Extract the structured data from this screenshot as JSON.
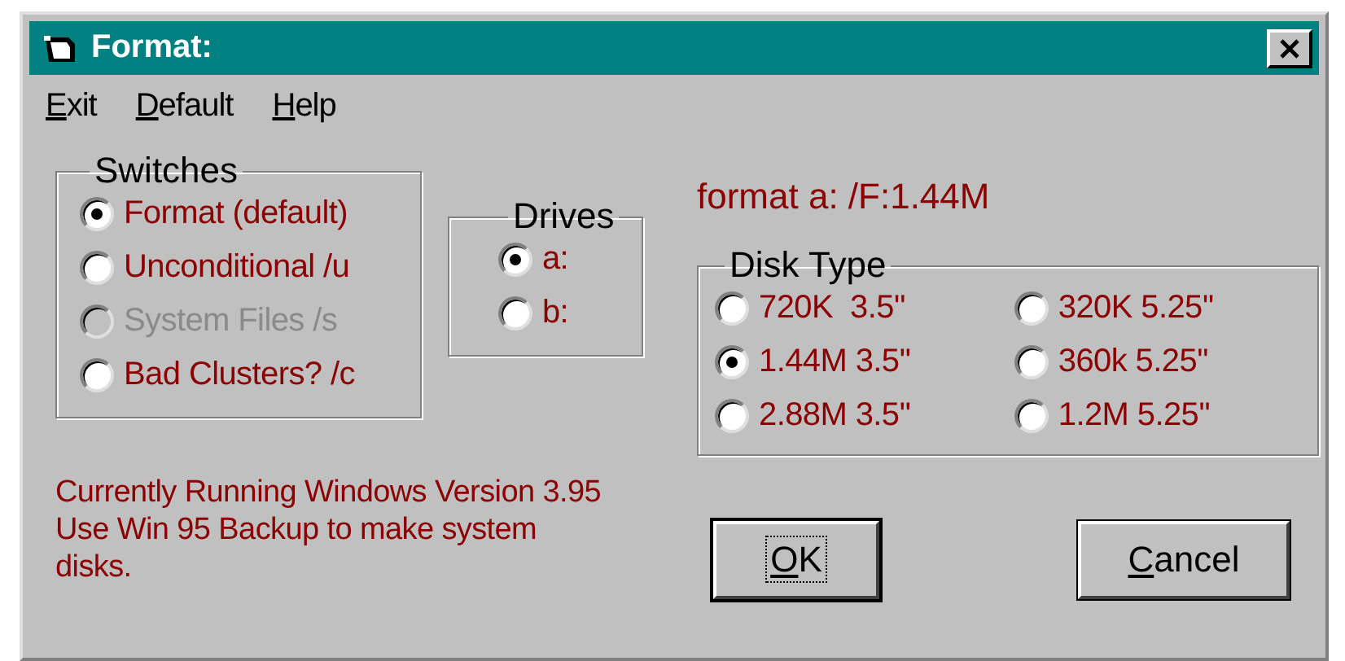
{
  "window": {
    "title": "Format:"
  },
  "menu": [
    {
      "mnemonic": "E",
      "rest": "xit"
    },
    {
      "mnemonic": "D",
      "rest": "efault"
    },
    {
      "mnemonic": "H",
      "rest": "elp"
    }
  ],
  "switches": {
    "title": "Switches",
    "options": [
      {
        "label": "Format (default)",
        "selected": true,
        "disabled": false
      },
      {
        "label": "Unconditional /u",
        "selected": false,
        "disabled": false
      },
      {
        "label": "System Files /s",
        "selected": false,
        "disabled": true
      },
      {
        "label": "Bad Clusters? /c",
        "selected": false,
        "disabled": false
      }
    ]
  },
  "drives": {
    "title": "Drives",
    "options": [
      {
        "label": "a:",
        "selected": true
      },
      {
        "label": "b:",
        "selected": false
      }
    ]
  },
  "command": "format a: /F:1.44M",
  "disk_type": {
    "title": "Disk Type",
    "options": [
      {
        "label": "720K  3.5''",
        "selected": false
      },
      {
        "label": "320K 5.25''",
        "selected": false
      },
      {
        "label": "1.44M 3.5''",
        "selected": true
      },
      {
        "label": "360k 5.25''",
        "selected": false
      },
      {
        "label": "2.88M 3.5''",
        "selected": false
      },
      {
        "label": "1.2M 5.25''",
        "selected": false
      }
    ]
  },
  "status": [
    "Currently Running Windows Version 3.95",
    "Use Win 95 Backup to make system",
    "disks."
  ],
  "buttons": [
    {
      "mnemonic": "O",
      "rest": "K",
      "default": true
    },
    {
      "mnemonic": "C",
      "rest": "ancel",
      "default": false
    }
  ]
}
